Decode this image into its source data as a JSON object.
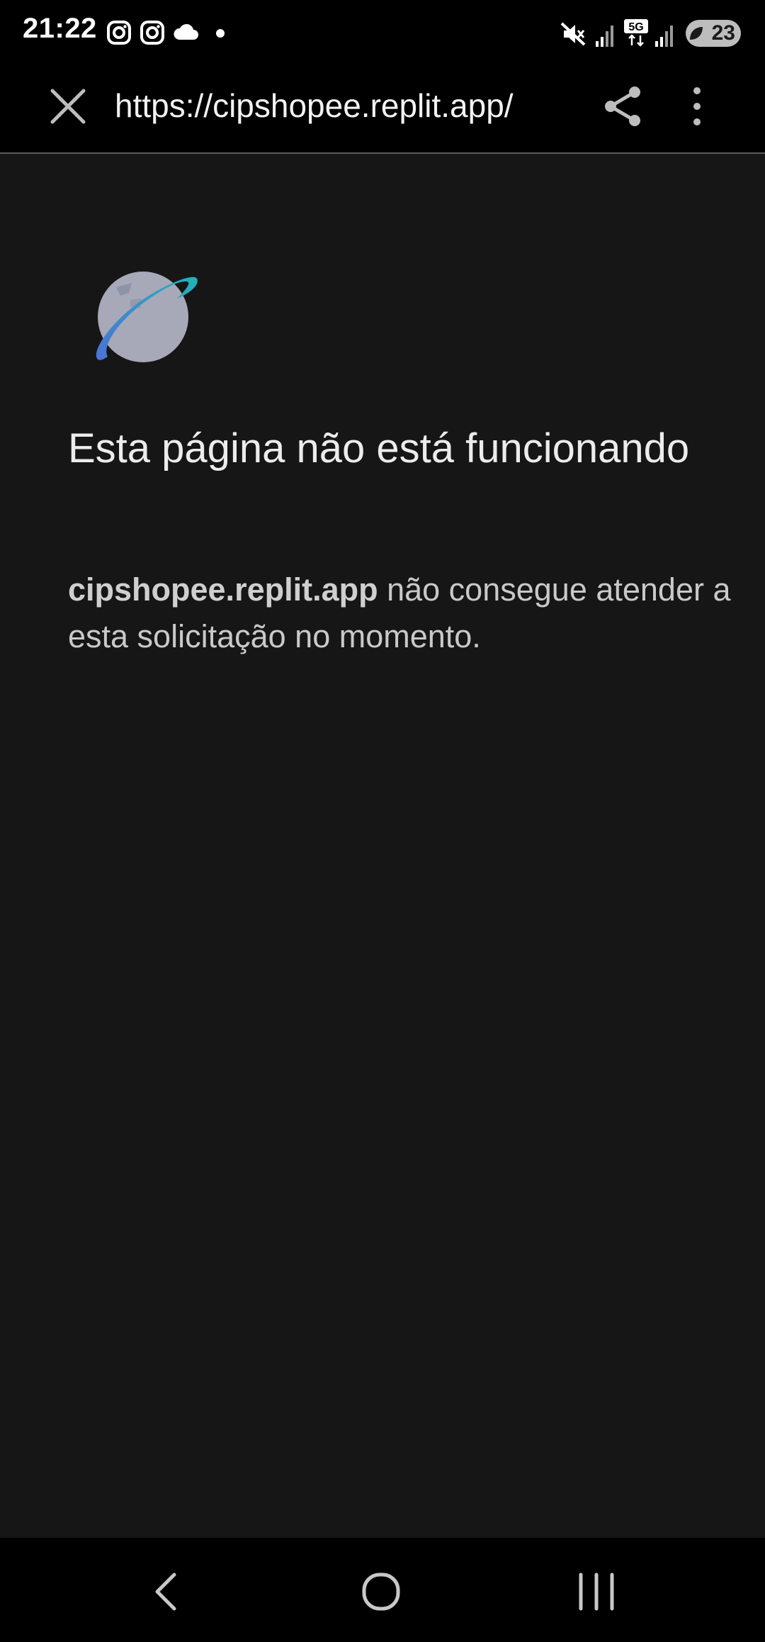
{
  "status_bar": {
    "time": "21:22",
    "notification_icons": [
      "instagram-icon",
      "instagram-icon",
      "cloud-icon",
      "dot-icon"
    ],
    "system_icons": [
      "mute-icon",
      "signal-icon",
      "5g-icon",
      "signal-icon"
    ],
    "battery_level": "23"
  },
  "toolbar": {
    "url": "https://cipshopee.replit.app/",
    "close_icon": "close-icon",
    "share_icon": "share-icon",
    "menu_icon": "more-vertical-icon"
  },
  "error_page": {
    "icon": "globe-icon",
    "title": "Esta página não está funcionando",
    "host": "cipshopee.replit.app",
    "message": " não consegue atender a esta solicitação no momento."
  },
  "nav_bar": {
    "icons": [
      "back-icon",
      "home-icon",
      "recents-icon"
    ]
  },
  "colors": {
    "background": "#161616",
    "bar": "#000000",
    "globe_teal": "#1fb3b8",
    "globe_blue": "#4a73d6",
    "globe_body": "#a7a9b8"
  }
}
